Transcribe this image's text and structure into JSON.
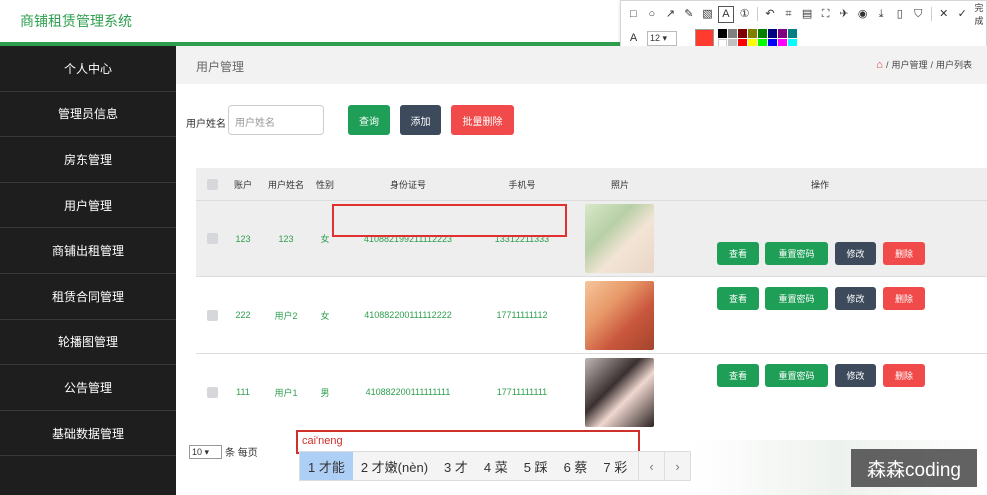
{
  "app": {
    "title": "商铺租赁管理系统"
  },
  "snip_toolbar": {
    "tools": [
      "rect-icon",
      "circle-icon",
      "arrow-icon",
      "pencil-icon",
      "mosaic-icon",
      "text-icon",
      "serial-icon",
      "undo-icon",
      "crop-icon",
      "ocr-icon",
      "scan-icon",
      "pin-icon",
      "record-icon",
      "download-icon",
      "copy-icon",
      "save-icon",
      "close-icon",
      "check-icon"
    ],
    "done_label": "完成",
    "font_label": "A",
    "font_size": "12 ▾",
    "selected_color": "#ff3b30",
    "palette": [
      "#000000",
      "#808080",
      "#800000",
      "#808000",
      "#008000",
      "#000080",
      "#800080",
      "#008080",
      "#ffffff",
      "#c0c0c0",
      "#ff0000",
      "#ffff00",
      "#00ff00",
      "#0000ff",
      "#ff00ff",
      "#00ffff"
    ]
  },
  "sidebar": {
    "items": [
      {
        "label": "个人中心"
      },
      {
        "label": "管理员信息"
      },
      {
        "label": "房东管理"
      },
      {
        "label": "用户管理"
      },
      {
        "label": "商铺出租管理"
      },
      {
        "label": "租赁合同管理"
      },
      {
        "label": "轮播图管理"
      },
      {
        "label": "公告管理"
      },
      {
        "label": "基础数据管理"
      }
    ]
  },
  "page": {
    "title": "用户管理",
    "breadcrumb": [
      "用户管理",
      "用户列表"
    ],
    "breadcrumb_sep": "/"
  },
  "search": {
    "label": "用户姓名",
    "placeholder": "用户姓名",
    "query_label": "查询",
    "add_label": "添加",
    "batch_delete_label": "批量删除"
  },
  "table": {
    "headers": [
      "账户",
      "用户姓名",
      "性别",
      "身份证号",
      "手机号",
      "照片",
      "操作"
    ],
    "rows": [
      {
        "account": "123",
        "name": "123",
        "gender": "女",
        "id_no": "410882199211112223",
        "phone": "13312211333"
      },
      {
        "account": "222",
        "name": "用户2",
        "gender": "女",
        "id_no": "410882200111112222",
        "phone": "17711111112"
      },
      {
        "account": "111",
        "name": "用户1",
        "gender": "男",
        "id_no": "410882200111111111",
        "phone": "17711111111"
      }
    ],
    "actions": {
      "view": "查看",
      "reset": "重置密码",
      "edit": "修改",
      "delete": "删除"
    }
  },
  "pager": {
    "page_size": "10 ▾",
    "per_page_label": "条 每页"
  },
  "ime": {
    "composition": "cai'neng",
    "candidates": [
      "1 才能",
      "2 才嫩(nèn)",
      "3 才",
      "4 菜",
      "5 踩",
      "6 蔡",
      "7 彩"
    ],
    "prev": "‹",
    "next": "›"
  },
  "watermark": "森森coding"
}
